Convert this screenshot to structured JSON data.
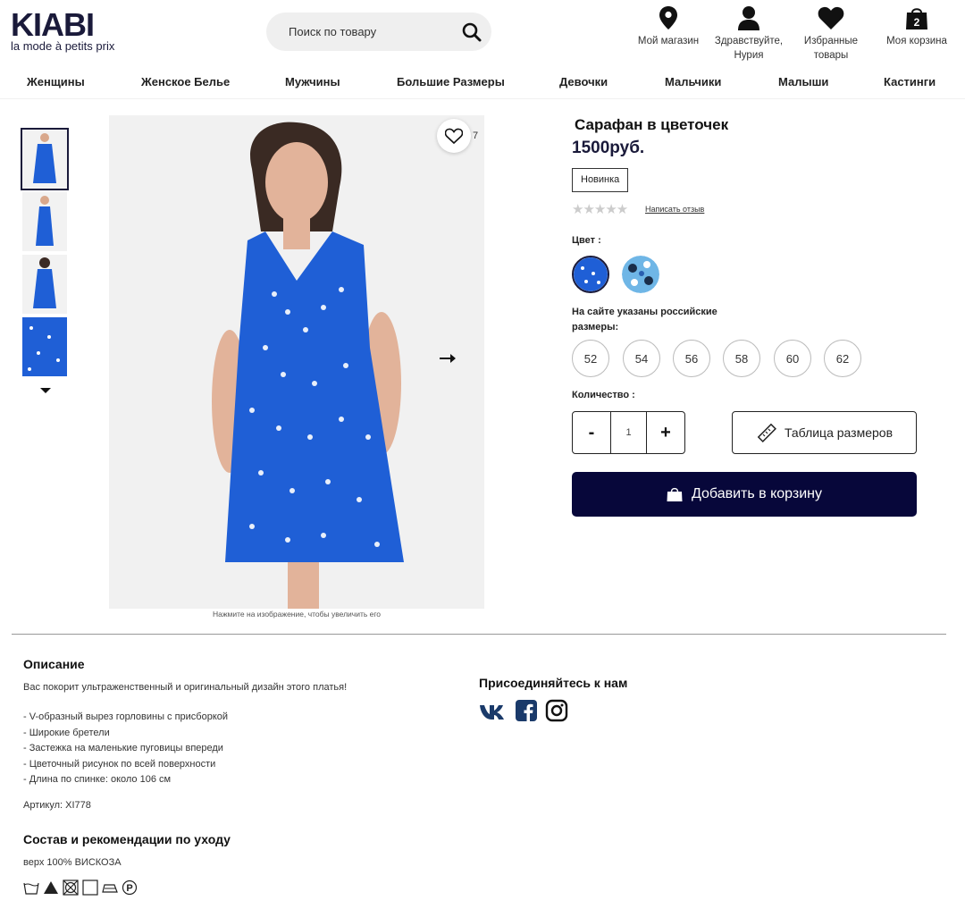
{
  "header": {
    "logo_main": "KIABI",
    "logo_tag": "la mode à petits prix",
    "search_placeholder": "Поиск по товару",
    "store_label": "Мой магазин",
    "user_label_1": "Здравствуйте,",
    "user_label_2": "Нурия",
    "fav_label_1": "Избранные",
    "fav_label_2": "товары",
    "cart_label": "Моя корзина",
    "cart_count": "2"
  },
  "nav": [
    "Женщины",
    "Женское Белье",
    "Мужчины",
    "Большие Размеры",
    "Девочки",
    "Мальчики",
    "Малыши",
    "Кастинги"
  ],
  "gallery": {
    "fav_count": "7",
    "zoom_hint": "Нажмите на изображение, чтобы увеличить его"
  },
  "product": {
    "title": "Сарафан в цветочек",
    "price": "1500руб.",
    "badge": "Новинка",
    "stars": "★★★★★",
    "review_link": "Написать отзыв",
    "color_label": "Цвет :",
    "sizes_note": "На сайте указаны российские размеры:",
    "sizes": [
      "52",
      "54",
      "56",
      "58",
      "60",
      "62"
    ],
    "qty_label": "Количество :",
    "qty_minus": "-",
    "qty_value": "1",
    "qty_plus": "+",
    "size_chart": "Таблица размеров",
    "add_to_cart": "Добавить в корзину"
  },
  "description": {
    "heading": "Описание",
    "intro": "Вас покорит ультраженственный и оригинальный дизайн этого платья!",
    "features": [
      "- V-образный вырез горловины с присборкой",
      "- Широкие бретели",
      "- Застежка на маленькие пуговицы впереди",
      "- Цветочный рисунок по всей поверхности",
      "- Длина по спинке: около 106 см"
    ],
    "sku": "Артикул: XI778",
    "care_heading": "Состав и рекомендации по уходу",
    "composition": "верх 100% ВИСКОЗА"
  },
  "social": {
    "heading": "Присоединяйтесь к нам",
    "icons": [
      "vk-icon",
      "facebook-icon",
      "instagram-icon"
    ]
  },
  "colors": {
    "brand": "#07073a",
    "dress_blue": "#1f5fd6"
  }
}
